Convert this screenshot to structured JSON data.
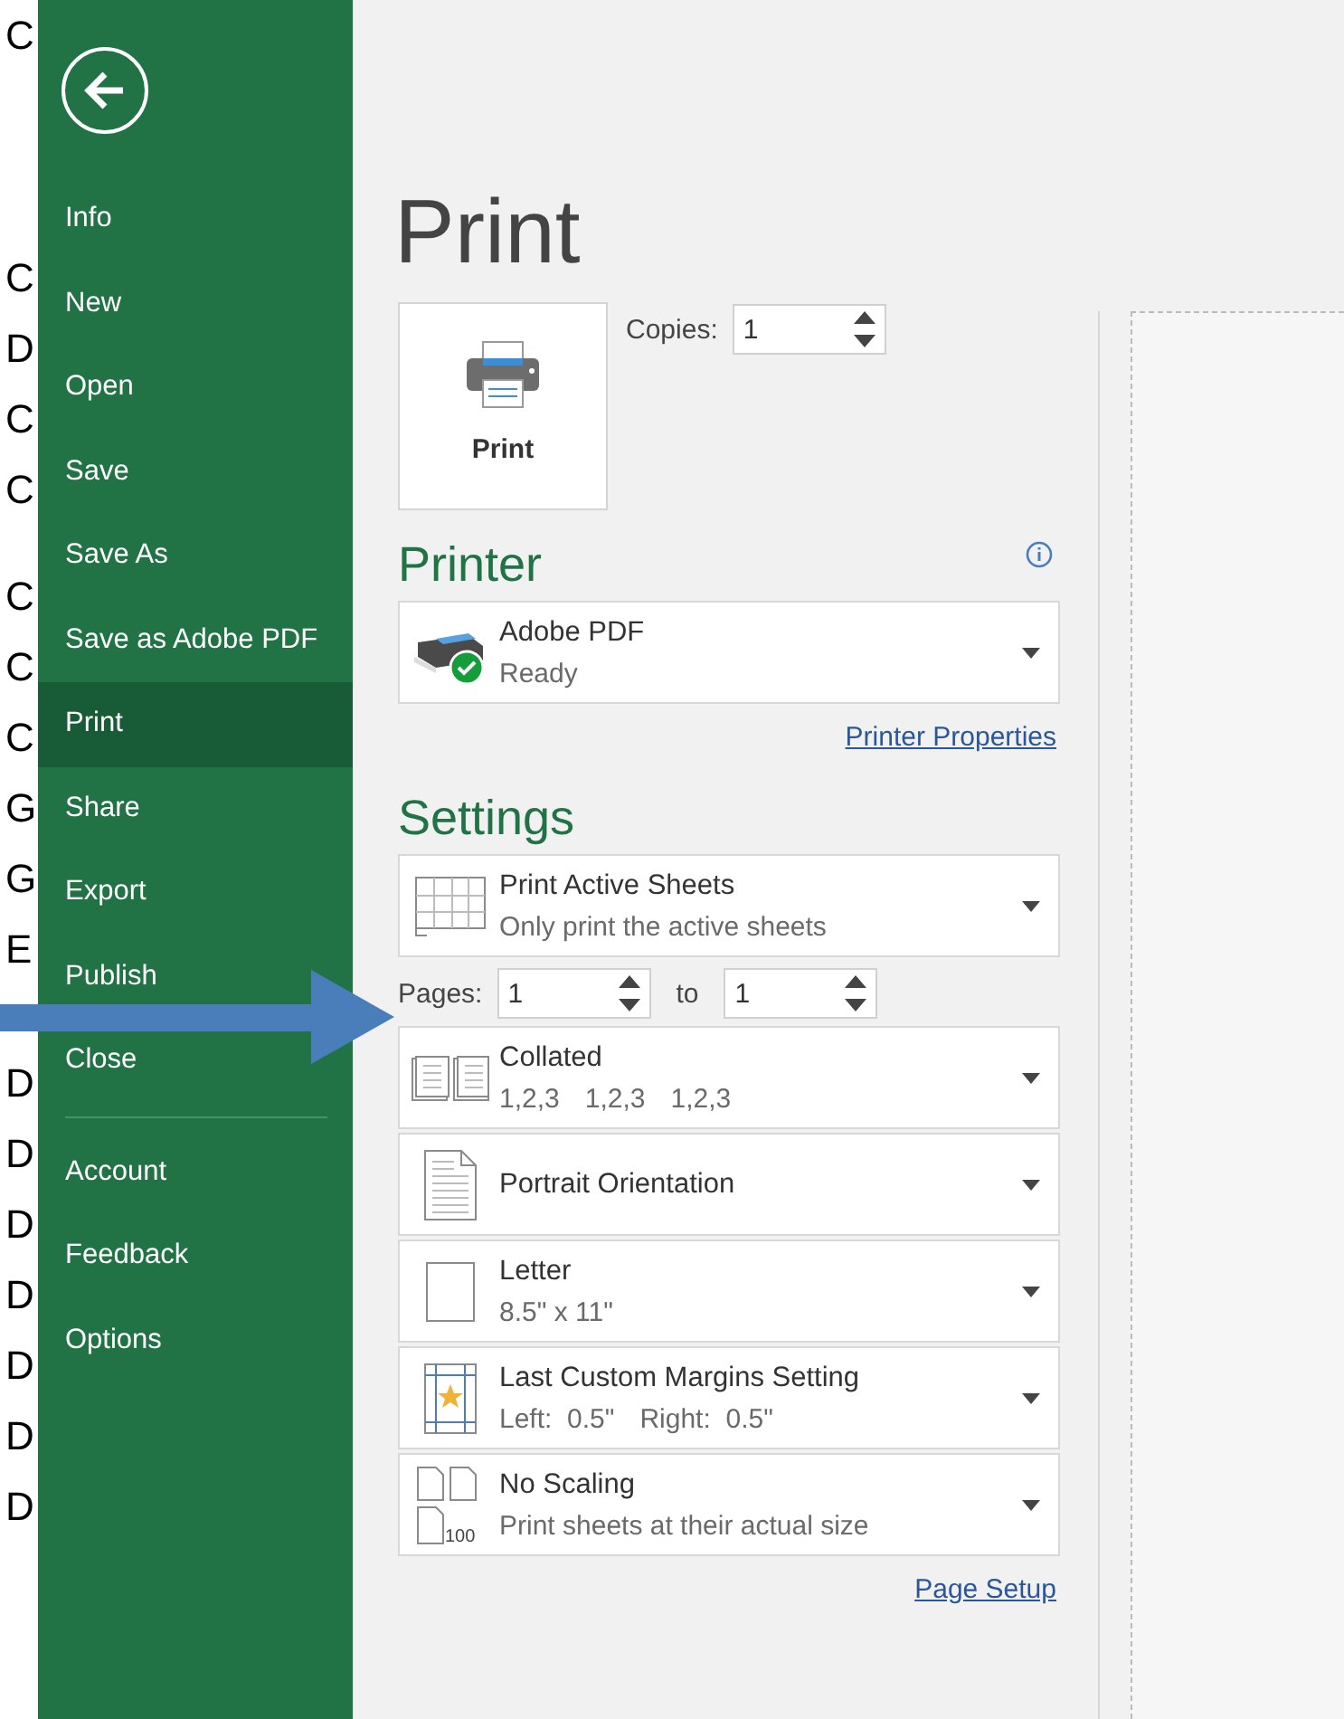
{
  "background_letters": [
    "C",
    "C",
    "D",
    "C",
    "C",
    "C",
    "C",
    "C",
    "G",
    "G",
    "E",
    "D",
    "D",
    "D",
    "D",
    "D",
    "D",
    "D"
  ],
  "sidebar": {
    "items": [
      {
        "label": "Info",
        "selected": false
      },
      {
        "label": "New",
        "selected": false
      },
      {
        "label": "Open",
        "selected": false
      },
      {
        "label": "Save",
        "selected": false
      },
      {
        "label": "Save As",
        "selected": false
      },
      {
        "label": "Save as Adobe PDF",
        "selected": false
      },
      {
        "label": "Print",
        "selected": true
      },
      {
        "label": "Share",
        "selected": false
      },
      {
        "label": "Export",
        "selected": false
      },
      {
        "label": "Publish",
        "selected": false
      },
      {
        "label": "Close",
        "selected": false
      }
    ],
    "footer_items": [
      {
        "label": "Account",
        "selected": false
      },
      {
        "label": "Feedback",
        "selected": false
      },
      {
        "label": "Options",
        "selected": false
      }
    ]
  },
  "title": "Print",
  "print_button": "Print",
  "copies": {
    "label": "Copies:",
    "value": "1"
  },
  "printer": {
    "heading": "Printer",
    "name": "Adobe PDF",
    "status": "Ready",
    "properties_link": "Printer Properties"
  },
  "settings": {
    "heading": "Settings",
    "options": [
      {
        "kind": "sheets",
        "title": "Print Active Sheets",
        "subtitle": [
          "Only print the active sheets"
        ]
      },
      {
        "kind": "collated",
        "title": "Collated",
        "subtitle": [
          "1,2,3",
          "1,2,3",
          "1,2,3"
        ]
      },
      {
        "kind": "portrait",
        "title": "Portrait Orientation"
      },
      {
        "kind": "paper",
        "title": "Letter",
        "subtitle": [
          "8.5\" x 11\""
        ]
      },
      {
        "kind": "margins",
        "title": "Last Custom Margins Setting",
        "subtitle": [
          "Left:  0.5\"",
          "Right:  0.5\""
        ]
      },
      {
        "kind": "scaling",
        "title": "No Scaling",
        "subtitle": [
          "Print sheets at their actual size"
        ],
        "icon_label": "100"
      }
    ],
    "pages": {
      "label": "Pages:",
      "from": "1",
      "to_label": "to",
      "to": "1"
    },
    "page_setup_link": "Page Setup"
  }
}
